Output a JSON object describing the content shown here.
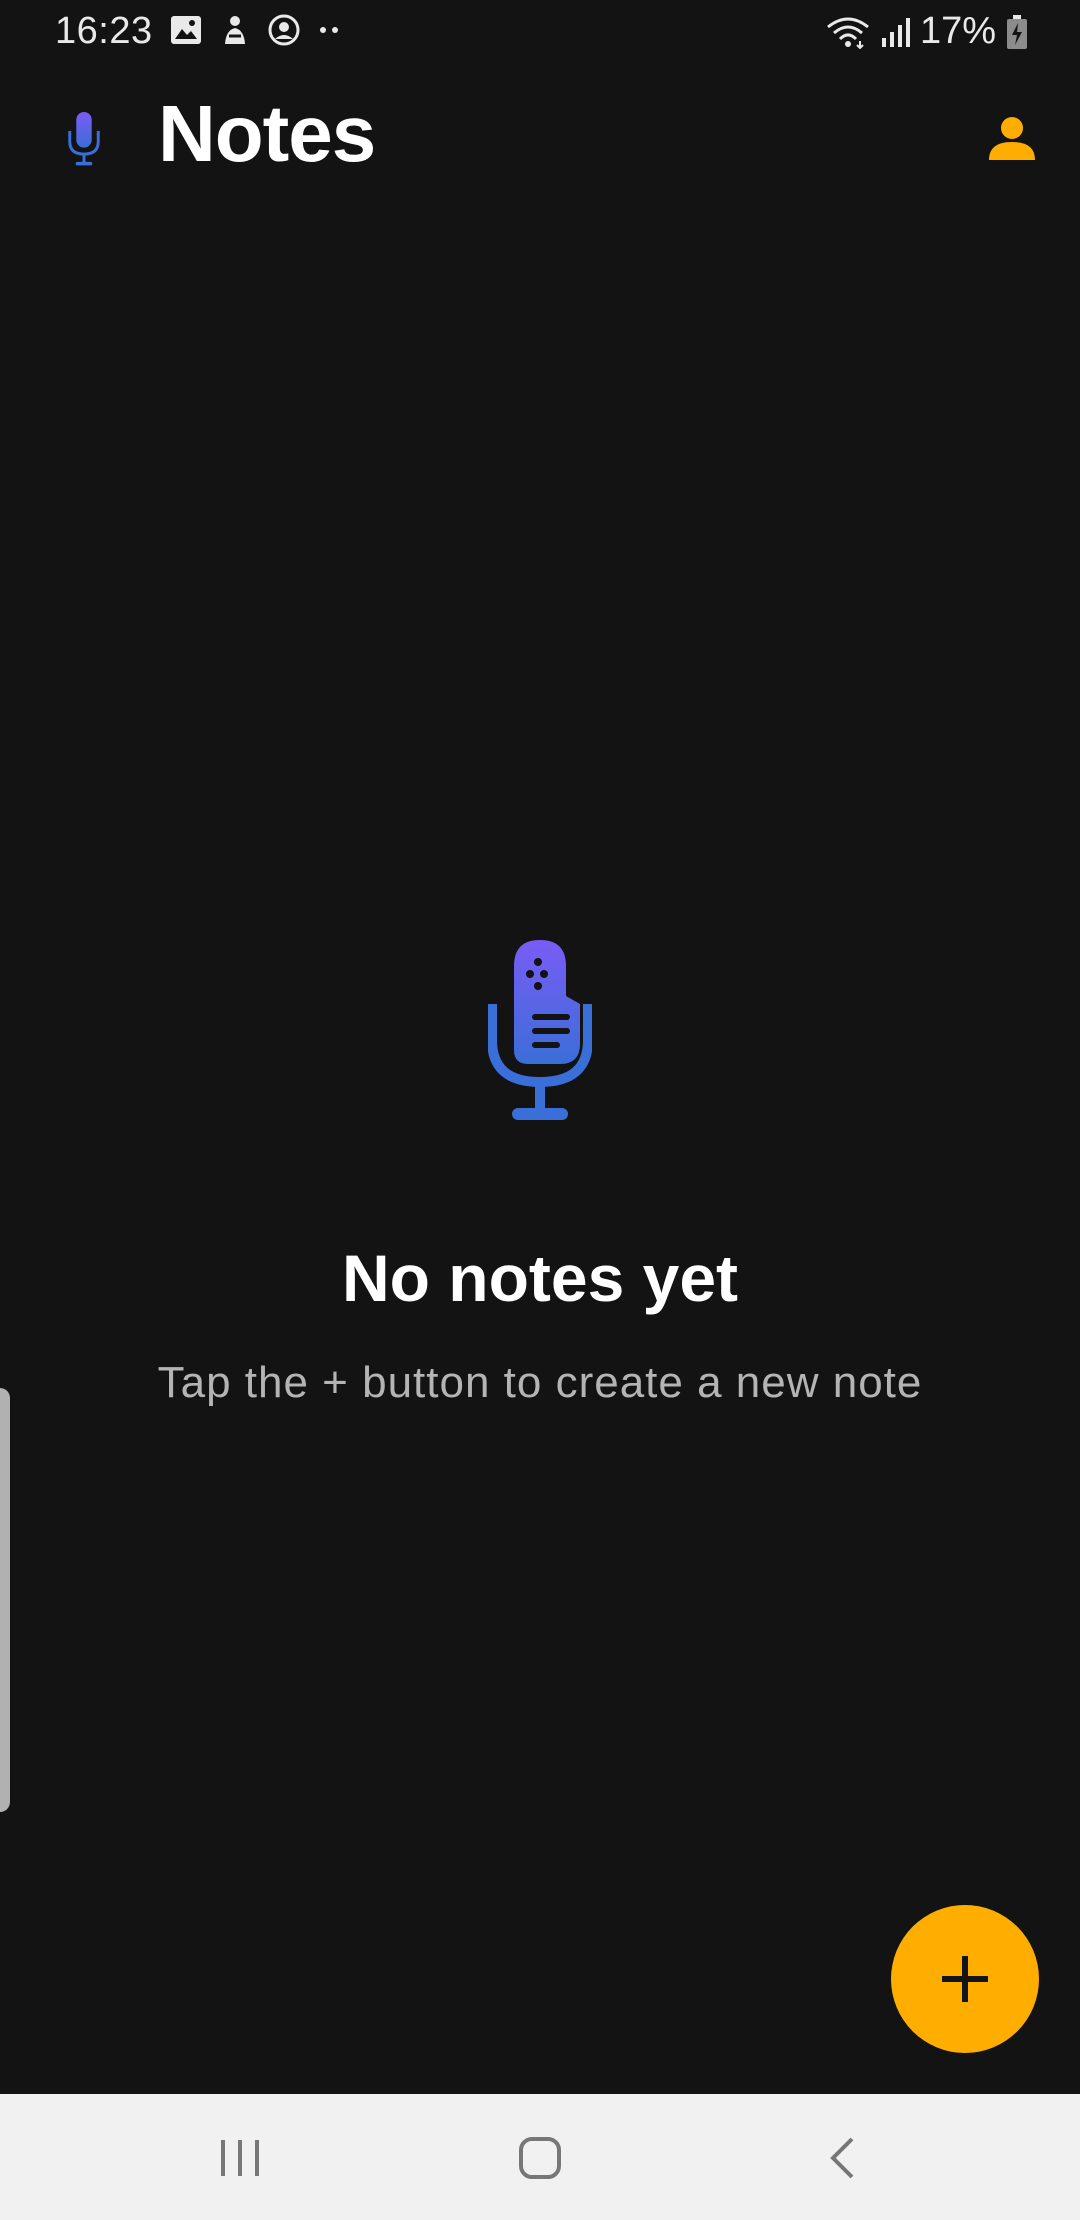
{
  "status_bar": {
    "time": "16:23",
    "battery": "17%"
  },
  "app_bar": {
    "title": "Notes",
    "logo_icon": "mic-note-icon",
    "profile_icon": "person-icon"
  },
  "empty_state": {
    "icon": "mic-note-icon",
    "title": "No notes yet",
    "subtitle": "Tap the + button to create a new note"
  },
  "fab": {
    "icon": "plus-icon"
  },
  "nav_bar": {
    "recents_icon": "recents-icon",
    "home_icon": "home-icon",
    "back_icon": "back-icon"
  },
  "colors": {
    "background": "#131314",
    "accent": "#ffae00",
    "mic_gradient_top": "#7a5cf5",
    "mic_gradient_bottom": "#3a6ed8",
    "text_primary": "#ffffff",
    "text_secondary": "#b4b4b4",
    "nav_bar": "#f1f1f1"
  }
}
